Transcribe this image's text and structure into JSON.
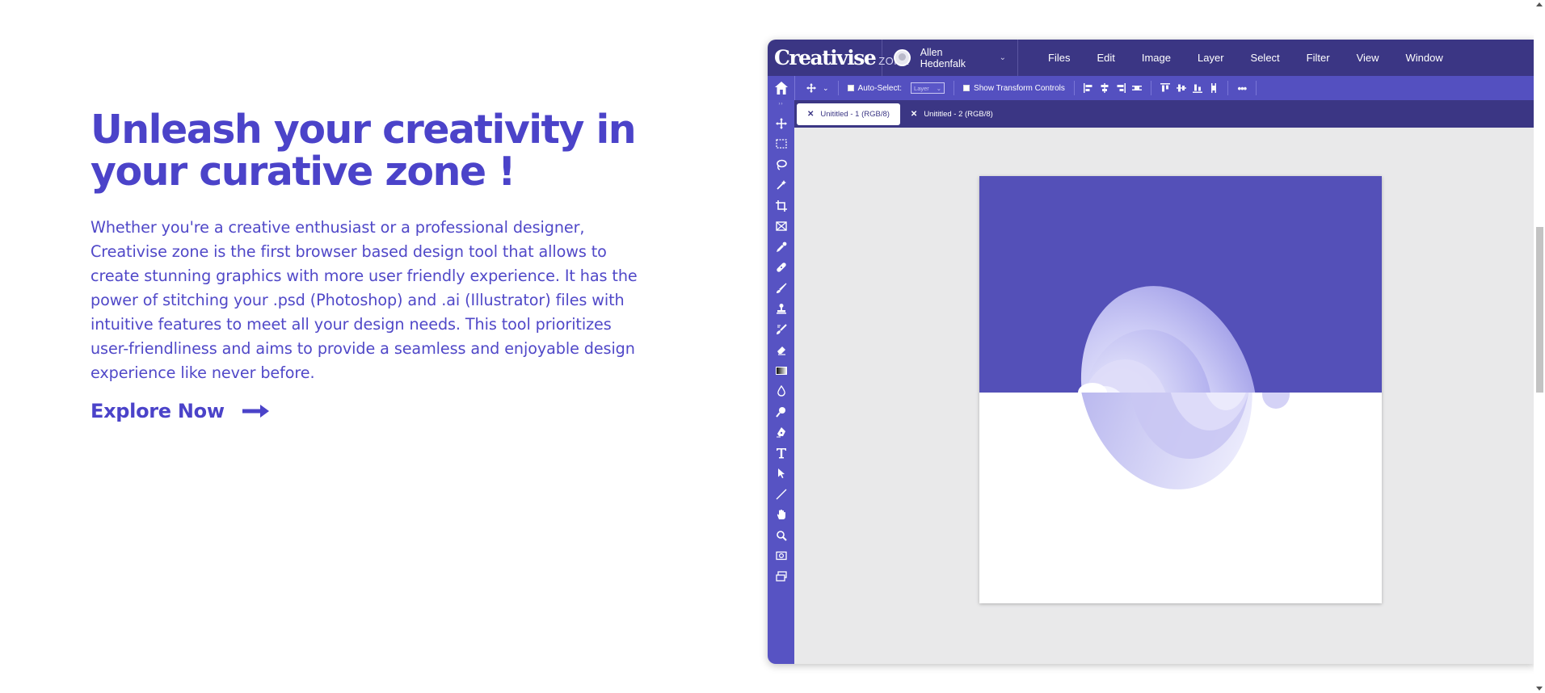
{
  "hero": {
    "title_line1": "Unleash your creativity in",
    "title_line2": "your curative zone !",
    "description": "Whether you're a creative enthusiast or a professional designer, Creativise zone is the first browser based design tool that allows to create stunning graphics with more user friendly experience. It has the power of stitching your .psd (Photoshop) and .ai (Illustrator) files with intuitive features to meet all your design needs. This tool prioritizes user-friendliness and aims to provide a seamless and enjoyable design experience like never before.",
    "cta_label": "Explore Now",
    "cta_icon": "arrow-right-icon",
    "accent_color": "#4b43c9"
  },
  "app": {
    "logo_main": "Creativise",
    "logo_sub": "ZONE",
    "user_name": "Allen Hedenfalk",
    "menu": [
      "Files",
      "Edit",
      "Image",
      "Layer",
      "Select",
      "Filter",
      "View",
      "Window"
    ],
    "options": {
      "auto_select_label": "Auto-Select:",
      "auto_select_value": "Layer",
      "transform_label": "Show Transform Controls"
    },
    "tabs": [
      {
        "label": "Unititled - 1 (RGB/8)",
        "active": true
      },
      {
        "label": "Unititled - 2 (RGB/8)",
        "active": false
      }
    ],
    "tools": [
      "move-tool-icon",
      "marquee-tool-icon",
      "lasso-tool-icon",
      "magic-wand-icon",
      "crop-tool-icon",
      "frame-tool-icon",
      "eyedropper-icon",
      "healing-brush-icon",
      "brush-tool-icon",
      "clone-stamp-icon",
      "history-brush-icon",
      "eraser-icon",
      "gradient-tool-icon",
      "blur-tool-icon",
      "dodge-tool-icon",
      "pen-tool-icon",
      "type-tool-icon",
      "path-select-icon",
      "line-tool-icon",
      "hand-tool-icon",
      "zoom-tool-icon",
      "quick-mask-icon",
      "screen-mode-icon"
    ],
    "colors": {
      "menubar": "#3b3684",
      "toolbar": "#5450c0",
      "doc_top": "#5450b8",
      "canvas_bg": "#e9e9ea"
    }
  }
}
